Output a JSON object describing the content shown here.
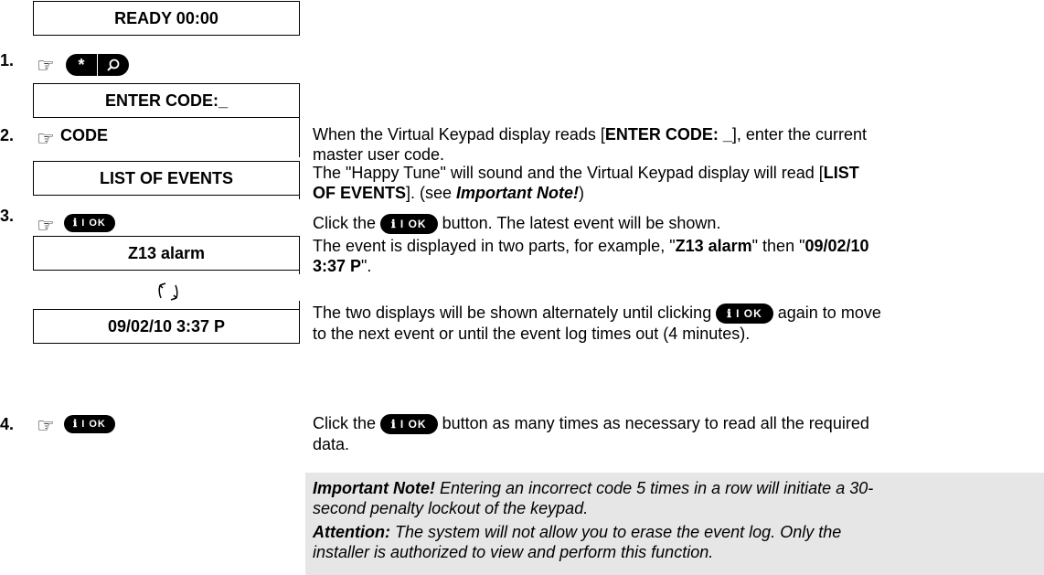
{
  "steps": {
    "s1": "1.",
    "s2": "2.",
    "s3": "3.",
    "s4": "4."
  },
  "lcd": {
    "ready": "READY 00:00",
    "enter_code": "ENTER CODE:_",
    "list_of_events": "LIST OF EVENTS",
    "z13": "Z13 alarm",
    "date": "09/02/10 3:37 P"
  },
  "keys": {
    "star": "*",
    "search_icon": "magnifier-icon",
    "ok_label": "ℹ I OK",
    "code_label": "CODE"
  },
  "text": {
    "step2_a": "When the Virtual Keypad display reads [",
    "step2_b": "ENTER CODE: _",
    "step2_c": "], enter the current",
    "step2_d": "master user code.",
    "lst_a": "The \"Happy Tune\" will sound and the Virtual Keypad display will read [",
    "lst_b": "LIST",
    "lst_c": "OF EVENTS",
    "lst_d": "]. (see ",
    "lst_e": "Important Note!",
    "lst_f": ")",
    "step3_a": "Click the ",
    "step3_b": " button. The latest event will be shown.",
    "evt_a": "The event is displayed in two parts, for example, \"",
    "evt_b": "Z13 alarm",
    "evt_c": "\" then \"",
    "evt_d": "09/02/10",
    "evt_e": "3:37 P",
    "evt_f": "\".",
    "alt_a": "The two displays will be shown alternately until clicking ",
    "alt_b": " again to move",
    "alt_c": "to the next event or until the event log times out (4 minutes).",
    "step4_a": "Click the ",
    "step4_b": " button as many times as necessary to read all the required",
    "step4_c": "data.",
    "note1_a": "Important Note!",
    "note1_b": " Entering an incorrect code 5 times in a row will initiate a 30-",
    "note1_c": "second penalty lockout of the keypad.",
    "note2_a": "Attention:",
    "note2_b": " The system will not allow you to erase the event log. Only the",
    "note2_c": "installer is authorized to view and perform this function."
  }
}
